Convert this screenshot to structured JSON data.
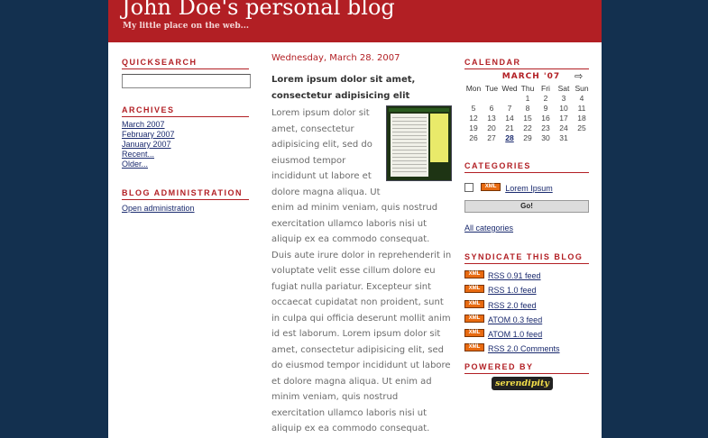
{
  "header": {
    "title": "John Doe's personal blog",
    "description": "My little place on the web..."
  },
  "left_sidebar": {
    "quicksearch": {
      "heading": "QUICKSEARCH",
      "value": "",
      "placeholder": ""
    },
    "archives": {
      "heading": "ARCHIVES",
      "items": [
        "March 2007",
        "February 2007",
        "January 2007",
        "Recent...",
        "Older..."
      ]
    },
    "admin": {
      "heading": "BLOG ADMINISTRATION",
      "link": "Open administration"
    }
  },
  "entry": {
    "date": "Wednesday, March 28. 2007",
    "title": "Lorem ipsum dolor sit amet, consectetur adipisicing elit",
    "body": "Lorem ipsum dolor sit amet, consectetur adipisicing elit, sed do eiusmod tempor incididunt ut labore et dolore magna aliqua. Ut enim ad minim veniam, quis nostrud exercitation ullamco laboris nisi ut aliquip ex ea commodo consequat. Duis aute irure dolor in reprehenderit in voluptate velit esse cillum dolore eu fugiat nulla pariatur. Excepteur sint occaecat cupidatat non proident, sunt in culpa qui officia deserunt mollit anim id est laborum. Lorem ipsum dolor sit amet, consectetur adipisicing elit, sed do eiusmod tempor incididunt ut labore et dolore magna aliqua. Ut enim ad minim veniam, quis nostrud exercitation ullamco laboris nisi ut aliquip ex ea commodo consequat."
  },
  "right_sidebar": {
    "calendar": {
      "heading": "CALENDAR",
      "month": "MARCH '07",
      "next_icon": "arrow-right-icon",
      "weekdays": [
        "Mon",
        "Tue",
        "Wed",
        "Thu",
        "Fri",
        "Sat",
        "Sun"
      ],
      "weeks": [
        [
          "",
          "",
          "",
          "1",
          "2",
          "3",
          "4"
        ],
        [
          "5",
          "6",
          "7",
          "8",
          "9",
          "10",
          "11"
        ],
        [
          "12",
          "13",
          "14",
          "15",
          "16",
          "17",
          "18"
        ],
        [
          "19",
          "20",
          "21",
          "22",
          "23",
          "24",
          "25"
        ],
        [
          "26",
          "27",
          "28",
          "29",
          "30",
          "31",
          ""
        ]
      ],
      "linked_day": "28"
    },
    "categories": {
      "heading": "CATEGORIES",
      "badge": "XML",
      "item": "Lorem Ipsum",
      "button": "Go!",
      "all_link": "All categories"
    },
    "syndicate": {
      "heading": "SYNDICATE THIS BLOG",
      "badge": "XML",
      "feeds": [
        "RSS 0.91 feed",
        "RSS 1.0 feed",
        "RSS 2.0 feed",
        "ATOM 0.3 feed",
        "ATOM 1.0 feed",
        "RSS 2.0 Comments"
      ]
    },
    "powered_by": {
      "heading": "POWERED BY",
      "logo": "serendipity"
    }
  },
  "colors": {
    "background": "#13304f",
    "header": "#b21f24",
    "accent": "#b21f24",
    "link": "#1a2a6e",
    "body_text": "#6b6b6b",
    "xml_badge": "#e86a10"
  }
}
